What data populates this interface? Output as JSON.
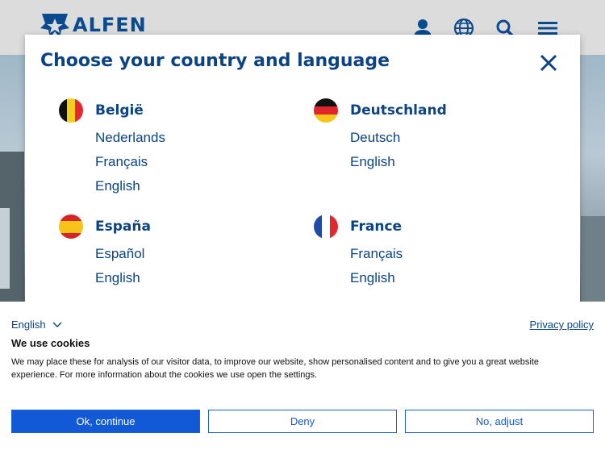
{
  "header": {
    "logo_text": "ALFEN",
    "icons": [
      "user-icon",
      "globe-icon",
      "search-icon",
      "menu-icon"
    ],
    "brand_color": "#0a4a8f"
  },
  "modal": {
    "title": "Choose your country and language",
    "countries": [
      {
        "name": "België",
        "flag": "belgium-flag-icon",
        "languages": [
          "Nederlands",
          "Français",
          "English"
        ]
      },
      {
        "name": "Deutschland",
        "flag": "germany-flag-icon",
        "languages": [
          "Deutsch",
          "English"
        ]
      },
      {
        "name": "España",
        "flag": "spain-flag-icon",
        "languages": [
          "Español",
          "English"
        ]
      },
      {
        "name": "France",
        "flag": "france-flag-icon",
        "languages": [
          "Français",
          "English"
        ]
      }
    ],
    "text_color": "#0b4384"
  },
  "cookie": {
    "language": "English",
    "privacy_link": "Privacy policy",
    "title": "We use cookies",
    "text": "We may place these for analysis of our visitor data, to improve our website, show personalised content and to give you a great website experience. For more information about the cookies we use open the settings.",
    "buttons": {
      "ok": "Ok, continue",
      "deny": "Deny",
      "adjust": "No, adjust"
    },
    "accent_color": "#1159d6"
  }
}
